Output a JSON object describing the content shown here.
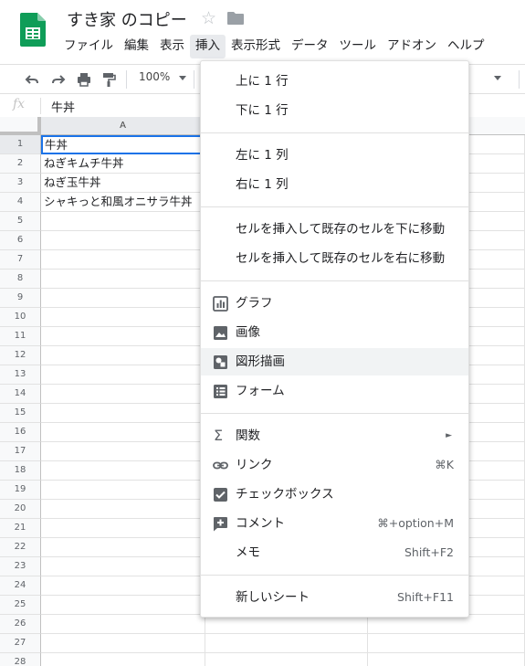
{
  "app": {
    "doc_title": "すき家 のコピー"
  },
  "menubar": {
    "items": [
      {
        "label": "ファイル"
      },
      {
        "label": "編集"
      },
      {
        "label": "表示"
      },
      {
        "label": "挿入"
      },
      {
        "label": "表示形式"
      },
      {
        "label": "データ"
      },
      {
        "label": "ツール"
      },
      {
        "label": "アドオン"
      },
      {
        "label": "ヘルプ"
      }
    ],
    "active_index": 3
  },
  "toolbar": {
    "zoom": "100%"
  },
  "formula_bar": {
    "fx": "fx",
    "value": "牛丼"
  },
  "grid": {
    "columns": [
      "A",
      "",
      ""
    ],
    "selected_cell": "A1",
    "rows": [
      {
        "num": "1",
        "a": "牛丼"
      },
      {
        "num": "2",
        "a": "ねぎキムチ牛丼"
      },
      {
        "num": "3",
        "a": "ねぎ玉牛丼"
      },
      {
        "num": "4",
        "a": "シャキっと和風オニサラ牛丼"
      },
      {
        "num": "5",
        "a": ""
      },
      {
        "num": "6",
        "a": ""
      },
      {
        "num": "7",
        "a": ""
      },
      {
        "num": "8",
        "a": ""
      },
      {
        "num": "9",
        "a": ""
      },
      {
        "num": "10",
        "a": ""
      },
      {
        "num": "11",
        "a": ""
      },
      {
        "num": "12",
        "a": ""
      },
      {
        "num": "13",
        "a": ""
      },
      {
        "num": "14",
        "a": ""
      },
      {
        "num": "15",
        "a": ""
      },
      {
        "num": "16",
        "a": ""
      },
      {
        "num": "17",
        "a": ""
      },
      {
        "num": "18",
        "a": ""
      },
      {
        "num": "19",
        "a": ""
      },
      {
        "num": "20",
        "a": ""
      },
      {
        "num": "21",
        "a": ""
      },
      {
        "num": "22",
        "a": ""
      },
      {
        "num": "23",
        "a": ""
      },
      {
        "num": "24",
        "a": ""
      },
      {
        "num": "25",
        "a": ""
      },
      {
        "num": "26",
        "a": ""
      },
      {
        "num": "27",
        "a": ""
      },
      {
        "num": "28",
        "a": ""
      }
    ]
  },
  "insert_menu": {
    "row_above": "上に 1 行",
    "row_below": "下に 1 行",
    "col_left": "左に 1 列",
    "col_right": "右に 1 列",
    "shift_down": "セルを挿入して既存のセルを下に移動",
    "shift_right": "セルを挿入して既存のセルを右に移動",
    "chart": "グラフ",
    "image": "画像",
    "drawing": "図形描画",
    "form": "フォーム",
    "function": "関数",
    "function_arrow": "►",
    "link": "リンク",
    "link_shortcut": "⌘K",
    "checkbox": "チェックボックス",
    "comment": "コメント",
    "comment_shortcut": "⌘+option+M",
    "note": "メモ",
    "note_shortcut": "Shift+F2",
    "new_sheet": "新しいシート",
    "new_sheet_shortcut": "Shift+F11"
  },
  "colors": {
    "sheets_green": "#0f9d58",
    "selection_blue": "#1a73e8",
    "icon_gray": "#5f6368"
  }
}
